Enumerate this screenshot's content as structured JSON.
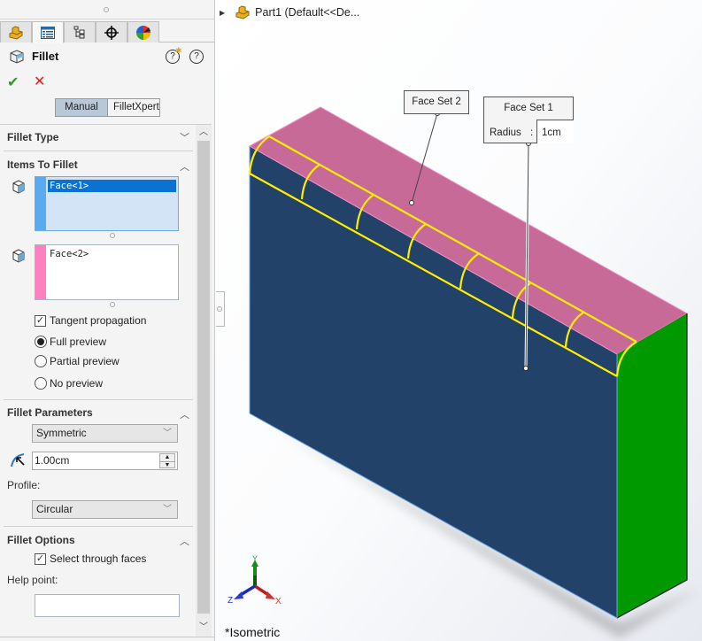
{
  "panel": {
    "tabs": [
      {
        "name": "featuremanager-tab",
        "icon": "part-icon"
      },
      {
        "name": "propertymanager-tab",
        "icon": "property-list-icon",
        "active": true
      },
      {
        "name": "configurationmanager-tab",
        "icon": "configuration-icon"
      },
      {
        "name": "dimxpertmanager-tab",
        "icon": "crosshair-icon"
      },
      {
        "name": "displaymanager-tab",
        "icon": "appearance-pie-icon"
      }
    ],
    "title": "Fillet",
    "help_whats_new": "?",
    "help": "?",
    "ok_symbol": "✔",
    "cancel_symbol": "✕",
    "mode": {
      "manual": "Manual",
      "filletxpert": "FilletXpert",
      "selected": "Manual"
    },
    "sections": {
      "fillet_type": {
        "label": "Fillet Type",
        "expanded": false
      },
      "items_to_fillet": {
        "label": "Items To Fillet",
        "expanded": true,
        "list1": {
          "items": [
            "Face<1>"
          ],
          "selected": "Face<1>",
          "stripe_color": "#5aaaf0"
        },
        "list2": {
          "items": [
            "Face<2>"
          ],
          "stripe_color": "#ff80c0"
        },
        "tangent_propagation": {
          "label": "Tangent propagation",
          "checked": true
        },
        "preview_options": [
          {
            "label": "Full preview",
            "selected": true
          },
          {
            "label": "Partial preview",
            "selected": false
          },
          {
            "label": "No preview",
            "selected": false
          }
        ]
      },
      "fillet_parameters": {
        "label": "Fillet Parameters",
        "expanded": true,
        "method": "Symmetric",
        "radius": "1.00cm",
        "profile_label": "Profile:",
        "profile": "Circular"
      },
      "fillet_options": {
        "label": "Fillet Options",
        "expanded": true,
        "select_through_faces": {
          "label": "Select through faces",
          "checked": true
        },
        "help_point_label": "Help point:",
        "help_point_value": ""
      }
    }
  },
  "viewport": {
    "tree_root": "Part1  (Default<<De...",
    "callouts": {
      "face_set_2": {
        "title": "Face Set 2"
      },
      "face_set_1": {
        "title": "Face Set 1",
        "radius_label": "Radius",
        "separator": ":",
        "radius_value": "1cm"
      }
    },
    "triad": {
      "x": "X",
      "y": "Y",
      "z": "Z"
    },
    "view_name": "*Isometric",
    "colors": {
      "face_set_1": "#22426a",
      "face_set_2": "#c86a98",
      "end_face": "#009a00",
      "fillet_preview": "#ffee00"
    }
  }
}
